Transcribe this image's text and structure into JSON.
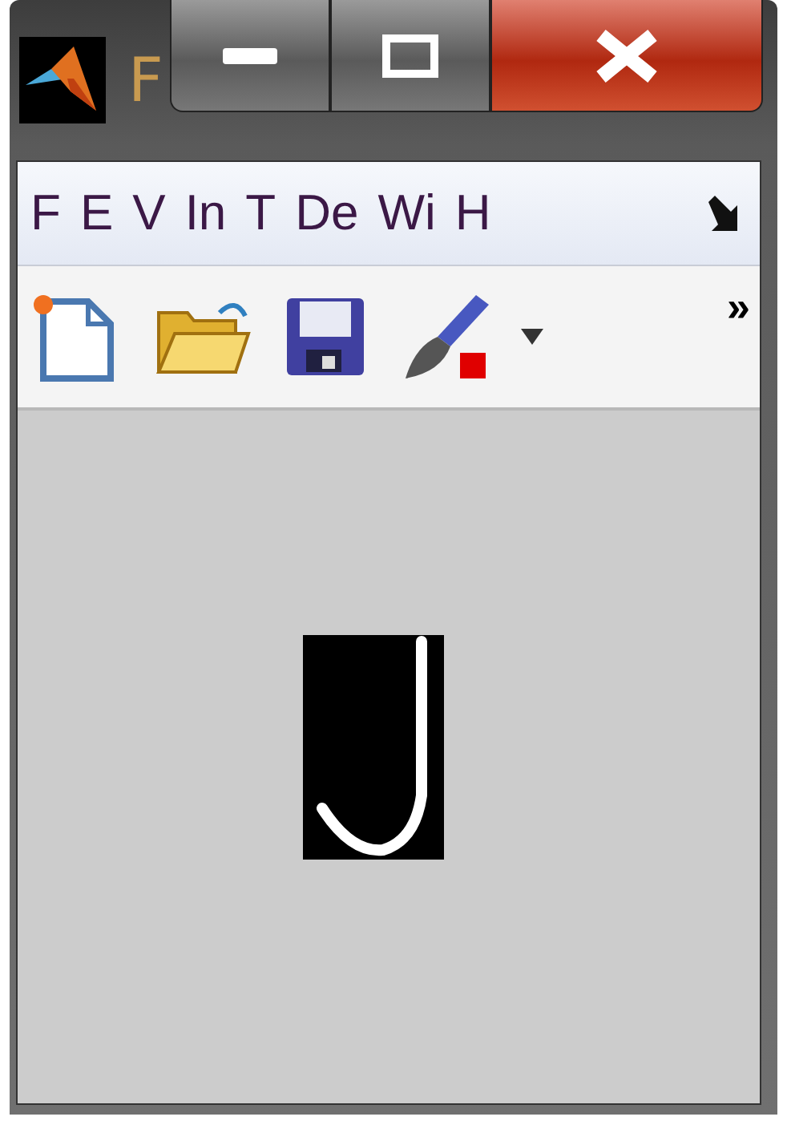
{
  "window": {
    "title": "F"
  },
  "menu": [
    {
      "label": "F"
    },
    {
      "label": "E"
    },
    {
      "label": "V"
    },
    {
      "label": "In"
    },
    {
      "label": "T"
    },
    {
      "label": "De"
    },
    {
      "label": "Wi"
    },
    {
      "label": "H"
    }
  ],
  "toolbar": {
    "tools": [
      {
        "kind": "new"
      },
      {
        "kind": "open"
      },
      {
        "kind": "save"
      },
      {
        "kind": "brush"
      }
    ],
    "overflow": "»"
  }
}
